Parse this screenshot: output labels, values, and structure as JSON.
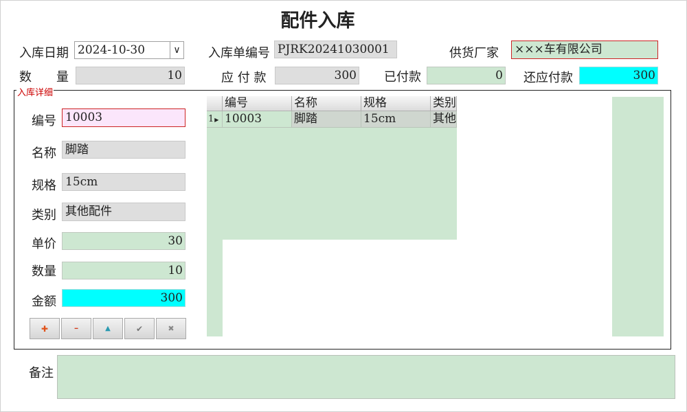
{
  "window": {
    "title": "配件入库"
  },
  "header": {
    "date_label": "入库日期",
    "date_value": "2024-10-30",
    "dropdown_glyph": "∨",
    "order_no_label": "入库单编号",
    "order_no_value": "PJRK20241030001",
    "supplier_label": "供货厂家",
    "supplier_value": "×××车有限公司",
    "qty_label": "数　　量",
    "qty_value": "10",
    "payable_label": "应 付 款",
    "payable_value": "300",
    "paid_label": "已付款",
    "paid_value": "0",
    "remaining_label": "还应付款",
    "remaining_value": "300"
  },
  "detail": {
    "group_label": "入库详细",
    "fields": {
      "code_label": "编号",
      "code_value": "10003",
      "name_label": "名称",
      "name_value": "脚踏",
      "spec_label": "规格",
      "spec_value": "15cm",
      "category_label": "类别",
      "category_value": "其他配件",
      "price_label": "单价",
      "price_value": "30",
      "quantity_label": "数量",
      "quantity_value": "10",
      "amount_label": "金额",
      "amount_value": "300"
    },
    "buttons": [
      {
        "icon": "add-icon",
        "glyph": "✚",
        "color": "#e0521a"
      },
      {
        "icon": "remove-icon",
        "glyph": "━",
        "color": "#d23a1a"
      },
      {
        "icon": "up-arrow-icon",
        "glyph": "▲",
        "color": "#2a9ab0"
      },
      {
        "icon": "check-icon",
        "glyph": "✔",
        "color": "#777777"
      },
      {
        "icon": "close-icon",
        "glyph": "✖",
        "color": "#888888"
      }
    ]
  },
  "grid": {
    "columns": [
      "编号",
      "名称",
      "规格",
      "类别"
    ],
    "rows": [
      {
        "row_num": "1",
        "cells": [
          "10003",
          "脚踏",
          "15cm",
          "其他"
        ]
      }
    ]
  },
  "notes": {
    "label": "备注",
    "value": ""
  },
  "colors": {
    "green": "#cde7d1",
    "cyan": "#00ffff",
    "gray": "#dedede",
    "pink": "#fbe6fb",
    "red_border": "#cc2222"
  }
}
